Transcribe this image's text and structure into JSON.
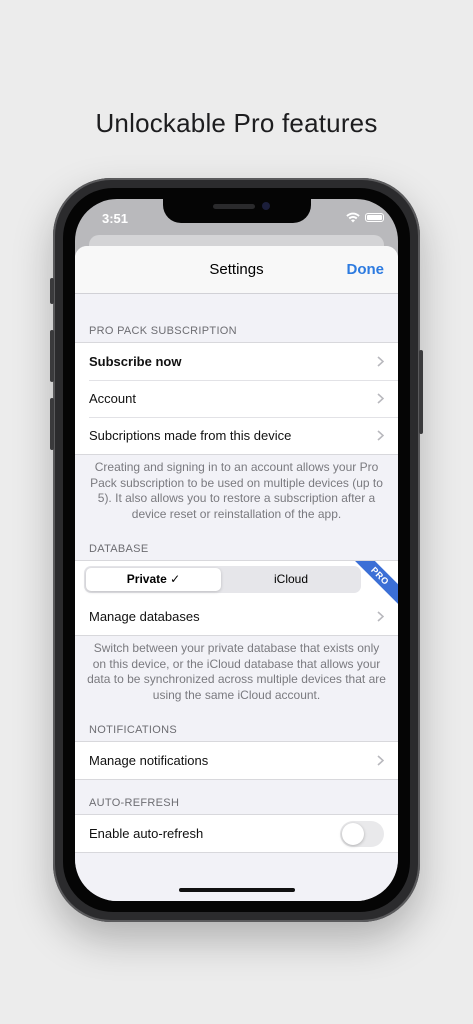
{
  "headline": "Unlockable Pro features",
  "status_bar": {
    "time": "3:51"
  },
  "nav": {
    "title": "Settings",
    "done_label": "Done"
  },
  "pro_pack": {
    "header": "PRO PACK SUBSCRIPTION",
    "rows": [
      "Subscribe now",
      "Account",
      "Subcriptions made from this device"
    ],
    "footer": "Creating and signing in to an account allows your Pro Pack subscription to be used on multiple devices (up to 5). It also allows you to restore a subscription after a device reset or reinstallation of the app."
  },
  "database": {
    "header": "DATABASE",
    "segments": [
      "Private ✓",
      "iCloud"
    ],
    "selected_segment": "Private ✓",
    "badge": "PRO",
    "manage_label": "Manage databases",
    "footer": "Switch between your private database that exists only on this device, or the iCloud database that allows your data to be synchronized across multiple devices that are using the same iCloud account."
  },
  "notifications": {
    "header": "NOTIFICATIONS",
    "manage_label": "Manage notifications"
  },
  "auto_refresh": {
    "header": "AUTO-REFRESH",
    "label": "Enable auto-refresh",
    "enabled": false
  },
  "colors": {
    "accent": "#2d7be0",
    "pro_badge": "#3b6fd6",
    "background": "#f2f2f7"
  }
}
